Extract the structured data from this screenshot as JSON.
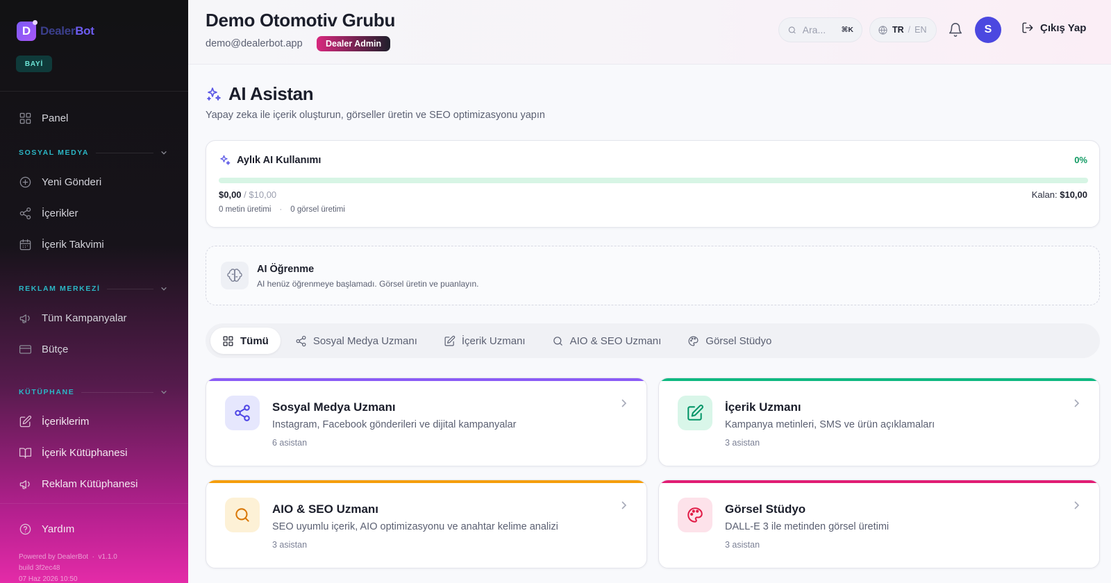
{
  "brand": {
    "logo_letter": "D",
    "name_part1": "Dealer",
    "name_part2": "Bot",
    "badge": "BAYİ"
  },
  "sidebar": {
    "panel": "Panel",
    "sections": [
      {
        "label": "SOSYAL MEDYA",
        "items": [
          "Yeni Gönderi",
          "İçerikler",
          "İçerik Takvimi"
        ]
      },
      {
        "label": "REKLAM MERKEZİ",
        "items": [
          "Tüm Kampanyalar",
          "Bütçe"
        ]
      },
      {
        "label": "KÜTÜPHANE",
        "items": [
          "İçeriklerim",
          "İçerik Kütüphanesi",
          "Reklam Kütüphanesi"
        ]
      }
    ],
    "help": "Yardım",
    "footer": {
      "powered": "Powered by DealerBot",
      "version": "v1.1.0",
      "build": "build 3f2ec48",
      "date": "07 Haz 2026 10:50"
    }
  },
  "header": {
    "org_name": "Demo Otomotiv Grubu",
    "email": "demo@dealerbot.app",
    "role": "Dealer Admin",
    "search_placeholder": "Ara...",
    "search_shortcut": "⌘K",
    "lang_active": "TR",
    "lang_sep": "/",
    "lang_other": "EN",
    "avatar_letter": "S",
    "logout": "Çıkış Yap"
  },
  "page": {
    "title": "AI Asistan",
    "subtitle": "Yapay zeka ile içerik oluşturun, görseller üretin ve SEO optimizasyonu yapın"
  },
  "usage": {
    "title": "Aylık AI Kullanımı",
    "percent_label": "0%",
    "progress_fraction": 0,
    "used": "$0,00",
    "limit": "/ $10,00",
    "remaining_label": "Kalan:",
    "remaining_value": "$10,00",
    "text_count": "0 metin üretimi",
    "separator": "·",
    "image_count": "0 görsel üretimi"
  },
  "learning": {
    "title": "AI Öğrenme",
    "description": "AI henüz öğrenmeye başlamadı. Görsel üretin ve puanlayın."
  },
  "tabs": [
    "Tümü",
    "Sosyal Medya Uzmanı",
    "İçerik Uzmanı",
    "AIO & SEO Uzmanı",
    "Görsel Stüdyo"
  ],
  "agents": [
    {
      "title": "Sosyal Medya Uzmanı",
      "description": "Instagram, Facebook gönderileri ve dijital kampanyalar",
      "count": "6 asistan",
      "icon": "share-icon",
      "accent": "#8b5cf6",
      "icon_bg": "#e6e7fd",
      "icon_color": "#4f46e5"
    },
    {
      "title": "İçerik Uzmanı",
      "description": "Kampanya metinleri, SMS ve ürün açıklamaları",
      "count": "3 asistan",
      "icon": "edit-icon",
      "accent": "#10b981",
      "icon_bg": "#d9f6e9",
      "icon_color": "#059669"
    },
    {
      "title": "AIO & SEO Uzmanı",
      "description": "SEO uyumlu içerik, AIO optimizasyonu ve anahtar kelime analizi",
      "count": "3 asistan",
      "icon": "search-icon",
      "accent": "#f59e0b",
      "icon_bg": "#fdf1d6",
      "icon_color": "#d97706"
    },
    {
      "title": "Görsel Stüdyo",
      "description": "DALL-E 3 ile metinden görsel üretimi",
      "count": "3 asistan",
      "icon": "palette-icon",
      "accent": "#e11d74",
      "icon_bg": "#fde2ea",
      "icon_color": "#e11d48"
    }
  ]
}
